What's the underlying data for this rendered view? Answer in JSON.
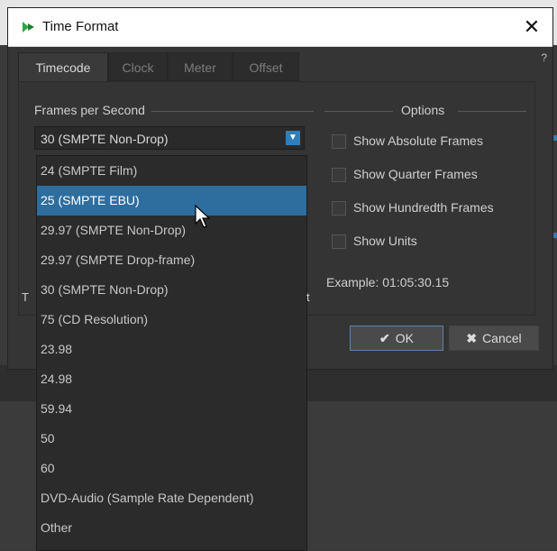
{
  "window": {
    "title": "Time Format",
    "close_glyph": "✕",
    "help_glyph": "?"
  },
  "tabs": [
    {
      "label": "Timecode",
      "active": true
    },
    {
      "label": "Clock"
    },
    {
      "label": "Meter"
    },
    {
      "label": "Offset"
    }
  ],
  "fps_group": {
    "label": "Frames per Second",
    "selected": "30 (SMPTE Non-Drop)",
    "options": [
      "24 (SMPTE Film)",
      "25 (SMPTE EBU)",
      "29.97 (SMPTE Non-Drop)",
      "29.97 (SMPTE Drop-frame)",
      "30 (SMPTE Non-Drop)",
      "75 (CD Resolution)",
      "23.98",
      "24.98",
      "59.94",
      "50",
      "60",
      "DVD-Audio (Sample Rate Dependent)",
      "Other"
    ],
    "highlighted_index": 1
  },
  "options_group": {
    "label": "Options",
    "checkboxes": [
      {
        "label": "Show Absolute Frames",
        "checked": false
      },
      {
        "label": "Show Quarter Frames",
        "checked": false
      },
      {
        "label": "Show Hundredth Frames",
        "checked": false
      },
      {
        "label": "Show Units",
        "checked": false
      }
    ],
    "example": "Example: 01:05:30.15"
  },
  "partial_text": {
    "left": "T",
    "right": "t"
  },
  "buttons": {
    "ok": "OK",
    "cancel": "Cancel",
    "ok_icon": "✔",
    "cancel_icon": "✖"
  },
  "colors": {
    "accent": "#2c7fbf",
    "highlight": "#2e6e9e",
    "dialog_bg": "#353535"
  },
  "icons": {
    "app": "app-logo-icon",
    "cursor": "mouse-cursor-icon"
  }
}
